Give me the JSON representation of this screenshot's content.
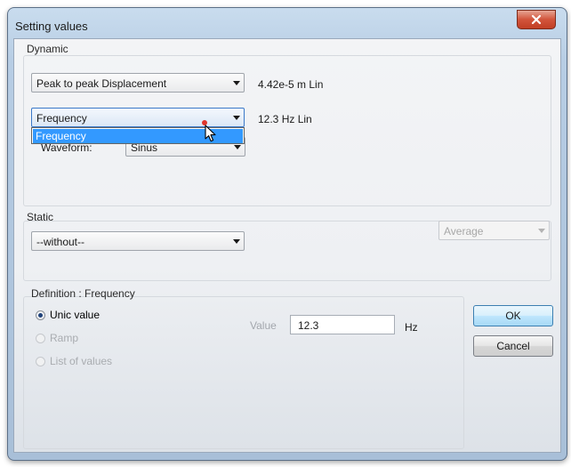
{
  "window": {
    "title": "Setting values",
    "close_icon": "close-icon"
  },
  "dynamic": {
    "group_label": "Dynamic",
    "measure_select": {
      "value": "Peak to peak Displacement"
    },
    "measure_readout": "4.42e-5 m Lin",
    "param_select": {
      "value": "Frequency"
    },
    "param_readout": "12.3 Hz Lin",
    "param_dropdown": {
      "options": [
        "Frequency"
      ],
      "highlighted": "Frequency"
    },
    "waveform_label": "Waveform:",
    "waveform_select": {
      "value": "Sinus"
    }
  },
  "static": {
    "group_label": "Static",
    "static_select": {
      "value": "--without--"
    },
    "mode_select": {
      "value": "Average",
      "disabled": true
    }
  },
  "definition": {
    "group_label": "Definition : Frequency",
    "options": [
      {
        "label": "Unic value",
        "checked": true,
        "enabled": true
      },
      {
        "label": "Ramp",
        "checked": false,
        "enabled": false
      },
      {
        "label": "List of values",
        "checked": false,
        "enabled": false
      }
    ],
    "value_label": "Value",
    "value_input": "12.3",
    "value_unit": "Hz"
  },
  "buttons": {
    "ok": "OK",
    "cancel": "Cancel"
  },
  "colors": {
    "accent_close": "#c13f25",
    "selection": "#3399ff",
    "default_button": "#3c7fb1"
  }
}
